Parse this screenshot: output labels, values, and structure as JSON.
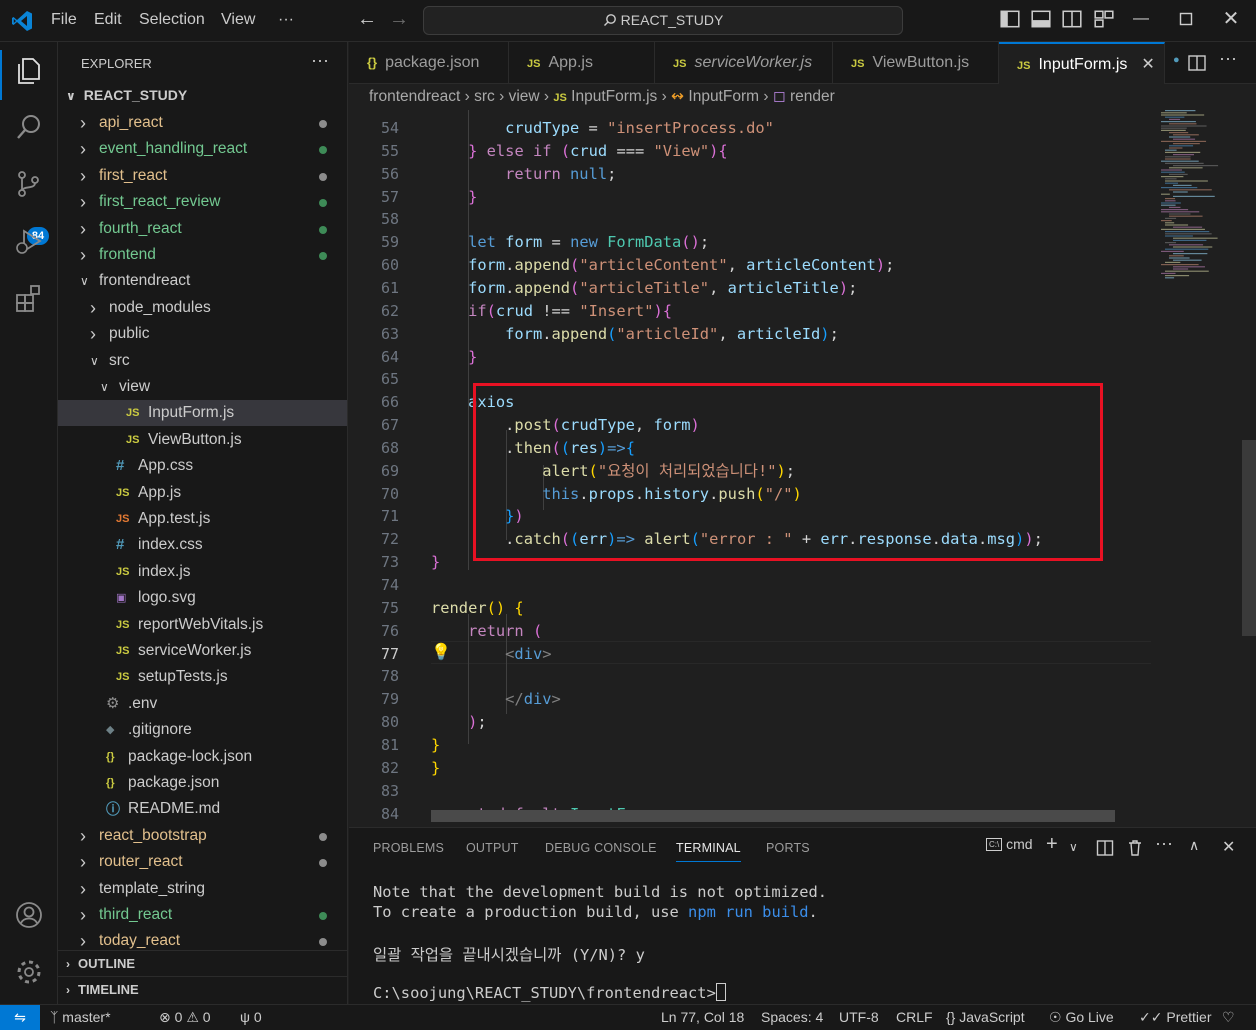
{
  "titlebar": {
    "menu": [
      "File",
      "Edit",
      "Selection",
      "View",
      "···"
    ],
    "search": "REACT_STUDY",
    "brand_color": "#0078d4"
  },
  "activitybar": {
    "items": [
      "explorer-icon",
      "search-icon",
      "source-control-icon",
      "run-debug-icon",
      "extensions-icon",
      "account-icon",
      "settings-icon"
    ],
    "scm_badge": "84"
  },
  "explorer": {
    "title": "EXPLORER",
    "more": "···",
    "root": "REACT_STUDY",
    "tree": [
      {
        "label": "api_react",
        "type": "folder",
        "open": false,
        "depth": 0,
        "status": "mod"
      },
      {
        "label": "event_handling_react",
        "type": "folder",
        "open": false,
        "depth": 0,
        "status": "add"
      },
      {
        "label": "first_react",
        "type": "folder",
        "open": false,
        "depth": 0,
        "status": "mod"
      },
      {
        "label": "first_react_review",
        "type": "folder",
        "open": false,
        "depth": 0,
        "status": "add"
      },
      {
        "label": "fourth_react",
        "type": "folder",
        "open": false,
        "depth": 0,
        "status": "add"
      },
      {
        "label": "frontend",
        "type": "folder",
        "open": false,
        "depth": 0,
        "status": "add"
      },
      {
        "label": "frontendreact",
        "type": "folder",
        "open": true,
        "depth": 0,
        "status": ""
      },
      {
        "label": "node_modules",
        "type": "folder",
        "open": false,
        "depth": 1,
        "status": ""
      },
      {
        "label": "public",
        "type": "folder",
        "open": false,
        "depth": 1,
        "status": ""
      },
      {
        "label": "src",
        "type": "folder",
        "open": true,
        "depth": 1,
        "status": ""
      },
      {
        "label": "view",
        "type": "folder",
        "open": true,
        "depth": 2,
        "status": ""
      },
      {
        "label": "InputForm.js",
        "type": "js",
        "depth": 3,
        "status": "",
        "selected": true
      },
      {
        "label": "ViewButton.js",
        "type": "js",
        "depth": 3,
        "status": ""
      },
      {
        "label": "App.css",
        "type": "css",
        "depth": 2,
        "status": ""
      },
      {
        "label": "App.js",
        "type": "js",
        "depth": 2,
        "status": ""
      },
      {
        "label": "App.test.js",
        "type": "jstest",
        "depth": 2,
        "status": ""
      },
      {
        "label": "index.css",
        "type": "css",
        "depth": 2,
        "status": ""
      },
      {
        "label": "index.js",
        "type": "js",
        "depth": 2,
        "status": ""
      },
      {
        "label": "logo.svg",
        "type": "svg",
        "depth": 2,
        "status": ""
      },
      {
        "label": "reportWebVitals.js",
        "type": "js",
        "depth": 2,
        "status": ""
      },
      {
        "label": "serviceWorker.js",
        "type": "js",
        "depth": 2,
        "status": ""
      },
      {
        "label": "setupTests.js",
        "type": "js",
        "depth": 2,
        "status": ""
      },
      {
        "label": ".env",
        "type": "gear",
        "depth": 1,
        "status": ""
      },
      {
        "label": ".gitignore",
        "type": "git",
        "depth": 1,
        "status": ""
      },
      {
        "label": "package-lock.json",
        "type": "json",
        "depth": 1,
        "status": ""
      },
      {
        "label": "package.json",
        "type": "json",
        "depth": 1,
        "status": ""
      },
      {
        "label": "README.md",
        "type": "info",
        "depth": 1,
        "status": ""
      },
      {
        "label": "react_bootstrap",
        "type": "folder",
        "open": false,
        "depth": 0,
        "status": "mod"
      },
      {
        "label": "router_react",
        "type": "folder",
        "open": false,
        "depth": 0,
        "status": "mod"
      },
      {
        "label": "template_string",
        "type": "folder",
        "open": false,
        "depth": 0,
        "status": ""
      },
      {
        "label": "third_react",
        "type": "folder",
        "open": false,
        "depth": 0,
        "status": "add"
      },
      {
        "label": "today_react",
        "type": "folder",
        "open": false,
        "depth": 0,
        "status": "mod"
      }
    ],
    "outline": "OUTLINE",
    "timeline": "TIMELINE"
  },
  "tabs": [
    {
      "label": "package.json",
      "icon": "{}",
      "italic": false
    },
    {
      "label": "App.js",
      "icon": "JS",
      "italic": false
    },
    {
      "label": "serviceWorker.js",
      "icon": "JS",
      "italic": true
    },
    {
      "label": "ViewButton.js",
      "icon": "JS",
      "italic": false
    },
    {
      "label": "InputForm.js",
      "icon": "JS",
      "italic": false,
      "active": true
    }
  ],
  "breadcrumb": [
    "frontendreact",
    "src",
    "view",
    "InputForm.js",
    "InputForm",
    "render"
  ],
  "editor": {
    "current_line": 77,
    "lines": [
      {
        "n": 54,
        "tokens": [
          [
            "        ",
            ""
          ],
          [
            "crudType",
            "id"
          ],
          [
            " = ",
            "op"
          ],
          [
            "\"insertProcess.do\"",
            "str"
          ]
        ]
      },
      {
        "n": 55,
        "tokens": [
          [
            "    ",
            ""
          ],
          [
            "}",
            "pb"
          ],
          [
            " ",
            ""
          ],
          [
            "else",
            "kw"
          ],
          [
            " ",
            ""
          ],
          [
            "if",
            "kw"
          ],
          [
            " ",
            ""
          ],
          [
            "(",
            "pb"
          ],
          [
            "crud",
            "id"
          ],
          [
            " === ",
            "op"
          ],
          [
            "\"View\"",
            "str"
          ],
          [
            ")",
            "pb"
          ],
          [
            "{",
            "pb"
          ]
        ]
      },
      {
        "n": 56,
        "tokens": [
          [
            "        ",
            ""
          ],
          [
            "return",
            "kw"
          ],
          [
            " ",
            ""
          ],
          [
            "null",
            "kb"
          ],
          [
            ";",
            "op"
          ]
        ]
      },
      {
        "n": 57,
        "tokens": [
          [
            "    ",
            ""
          ],
          [
            "}",
            "pb"
          ]
        ]
      },
      {
        "n": 58,
        "tokens": []
      },
      {
        "n": 59,
        "tokens": [
          [
            "    ",
            ""
          ],
          [
            "let",
            "kb"
          ],
          [
            " ",
            ""
          ],
          [
            "form",
            "id"
          ],
          [
            " = ",
            "op"
          ],
          [
            "new",
            "kb"
          ],
          [
            " ",
            ""
          ],
          [
            "FormData",
            "cls"
          ],
          [
            "()",
            "pb"
          ],
          [
            ";",
            "op"
          ]
        ]
      },
      {
        "n": 60,
        "tokens": [
          [
            "    ",
            ""
          ],
          [
            "form",
            "id"
          ],
          [
            ".",
            "op"
          ],
          [
            "append",
            "fn"
          ],
          [
            "(",
            "pb"
          ],
          [
            "\"articleContent\"",
            "str"
          ],
          [
            ", ",
            "op"
          ],
          [
            "articleContent",
            "id"
          ],
          [
            ")",
            "pb"
          ],
          [
            ";",
            "op"
          ]
        ]
      },
      {
        "n": 61,
        "tokens": [
          [
            "    ",
            ""
          ],
          [
            "form",
            "id"
          ],
          [
            ".",
            "op"
          ],
          [
            "append",
            "fn"
          ],
          [
            "(",
            "pb"
          ],
          [
            "\"articleTitle\"",
            "str"
          ],
          [
            ", ",
            "op"
          ],
          [
            "articleTitle",
            "id"
          ],
          [
            ")",
            "pb"
          ],
          [
            ";",
            "op"
          ]
        ]
      },
      {
        "n": 62,
        "tokens": [
          [
            "    ",
            ""
          ],
          [
            "if",
            "kw"
          ],
          [
            "(",
            "pb"
          ],
          [
            "crud",
            "id"
          ],
          [
            " !== ",
            "op"
          ],
          [
            "\"Insert\"",
            "str"
          ],
          [
            ")",
            "pb"
          ],
          [
            "{",
            "pb"
          ]
        ]
      },
      {
        "n": 63,
        "tokens": [
          [
            "        ",
            ""
          ],
          [
            "form",
            "id"
          ],
          [
            ".",
            "op"
          ],
          [
            "append",
            "fn"
          ],
          [
            "(",
            "pbl"
          ],
          [
            "\"articleId\"",
            "str"
          ],
          [
            ", ",
            "op"
          ],
          [
            "articleId",
            "id"
          ],
          [
            ")",
            "pbl"
          ],
          [
            ";",
            "op"
          ]
        ]
      },
      {
        "n": 64,
        "tokens": [
          [
            "    ",
            ""
          ],
          [
            "}",
            "pb"
          ]
        ]
      },
      {
        "n": 65,
        "tokens": []
      },
      {
        "n": 66,
        "tokens": [
          [
            "    ",
            ""
          ],
          [
            "axios",
            "id"
          ]
        ]
      },
      {
        "n": 67,
        "tokens": [
          [
            "        ",
            ""
          ],
          [
            ".",
            "op"
          ],
          [
            "post",
            "fn"
          ],
          [
            "(",
            "pb"
          ],
          [
            "crudType",
            "id"
          ],
          [
            ", ",
            "op"
          ],
          [
            "form",
            "id"
          ],
          [
            ")",
            "pb"
          ]
        ]
      },
      {
        "n": 68,
        "tokens": [
          [
            "        ",
            ""
          ],
          [
            ".",
            "op"
          ],
          [
            "then",
            "fn"
          ],
          [
            "(",
            "pb"
          ],
          [
            "(",
            "pbl"
          ],
          [
            "res",
            "id"
          ],
          [
            ")",
            "pbl"
          ],
          [
            "=>",
            "kb"
          ],
          [
            "{",
            "pbl"
          ]
        ]
      },
      {
        "n": 69,
        "tokens": [
          [
            "            ",
            ""
          ],
          [
            "alert",
            "fn"
          ],
          [
            "(",
            "py"
          ],
          [
            "\"요청이 처리되었습니다!\"",
            "str"
          ],
          [
            ")",
            "py"
          ],
          [
            ";",
            "op"
          ]
        ]
      },
      {
        "n": 70,
        "tokens": [
          [
            "            ",
            ""
          ],
          [
            "this",
            "kb"
          ],
          [
            ".",
            "op"
          ],
          [
            "props",
            "id"
          ],
          [
            ".",
            "op"
          ],
          [
            "history",
            "id"
          ],
          [
            ".",
            "op"
          ],
          [
            "push",
            "fn"
          ],
          [
            "(",
            "py"
          ],
          [
            "\"/\"",
            "str"
          ],
          [
            ")",
            "py"
          ]
        ]
      },
      {
        "n": 71,
        "tokens": [
          [
            "        ",
            ""
          ],
          [
            "}",
            "pbl"
          ],
          [
            ")",
            "pb"
          ]
        ]
      },
      {
        "n": 72,
        "tokens": [
          [
            "        ",
            ""
          ],
          [
            ".",
            "op"
          ],
          [
            "catch",
            "fn"
          ],
          [
            "(",
            "pb"
          ],
          [
            "(",
            "pbl"
          ],
          [
            "err",
            "id"
          ],
          [
            ")",
            "pbl"
          ],
          [
            "=>",
            "kb"
          ],
          [
            " ",
            ""
          ],
          [
            "alert",
            "fn"
          ],
          [
            "(",
            "pbl"
          ],
          [
            "\"error : \"",
            "str"
          ],
          [
            " + ",
            "op"
          ],
          [
            "err",
            "id"
          ],
          [
            ".",
            "op"
          ],
          [
            "response",
            "id"
          ],
          [
            ".",
            "op"
          ],
          [
            "data",
            "id"
          ],
          [
            ".",
            "op"
          ],
          [
            "msg",
            "id"
          ],
          [
            ")",
            "pbl"
          ],
          [
            ")",
            "pb"
          ],
          [
            ";",
            "op"
          ]
        ]
      },
      {
        "n": 73,
        "tokens": [
          [
            "",
            ""
          ],
          [
            "}",
            "pb"
          ]
        ]
      },
      {
        "n": 74,
        "tokens": []
      },
      {
        "n": 75,
        "tokens": [
          [
            "",
            ""
          ],
          [
            "render",
            "fn"
          ],
          [
            "() ",
            "py"
          ],
          [
            "{",
            "py"
          ]
        ]
      },
      {
        "n": 76,
        "tokens": [
          [
            "    ",
            ""
          ],
          [
            "return",
            "kw"
          ],
          [
            " ",
            ""
          ],
          [
            "(",
            "pb"
          ]
        ]
      },
      {
        "n": 77,
        "tokens": [
          [
            "        ",
            ""
          ],
          [
            "<",
            "tag"
          ],
          [
            "div",
            "tagn"
          ],
          [
            ">",
            "tag"
          ]
        ]
      },
      {
        "n": 78,
        "tokens": []
      },
      {
        "n": 79,
        "tokens": [
          [
            "        ",
            ""
          ],
          [
            "</",
            "tag"
          ],
          [
            "div",
            "tagn"
          ],
          [
            ">",
            "tag"
          ]
        ]
      },
      {
        "n": 80,
        "tokens": [
          [
            "    ",
            ""
          ],
          [
            ")",
            "pb"
          ],
          [
            ";",
            "op"
          ]
        ]
      },
      {
        "n": 81,
        "tokens": [
          [
            "",
            ""
          ],
          [
            "}",
            "py"
          ]
        ]
      },
      {
        "n": 82,
        "tokens": [
          [
            "",
            ""
          ],
          [
            "}",
            "py"
          ]
        ]
      },
      {
        "n": 83,
        "tokens": []
      },
      {
        "n": 84,
        "tokens": [
          [
            "",
            ""
          ],
          [
            "export",
            "kw"
          ],
          [
            " ",
            ""
          ],
          [
            "default",
            "kw"
          ],
          [
            " ",
            ""
          ],
          [
            "InputForm",
            "cls"
          ],
          [
            ";",
            "op"
          ]
        ]
      }
    ]
  },
  "panel": {
    "tabs": [
      "PROBLEMS",
      "OUTPUT",
      "DEBUG CONSOLE",
      "TERMINAL",
      "PORTS"
    ],
    "active_tab": "TERMINAL",
    "shell": "cmd",
    "terminal": {
      "line1": "Note that the development build is not optimized.",
      "line2_prefix": "To create a production build, use ",
      "line2_cmd": "npm run build",
      "line2_suffix": ".",
      "line3": "일괄 작업을 끝내시겠습니까 (Y/N)? y",
      "prompt": "C:\\soojung\\REACT_STUDY\\frontendreact>"
    }
  },
  "statusbar": {
    "branch": "master*",
    "errors": "0",
    "warnings": "0",
    "ports": "0",
    "position": "Ln 77, Col 18",
    "spaces": "Spaces: 4",
    "encoding": "UTF-8",
    "eol": "CRLF",
    "language": "JavaScript",
    "golive": "Go Live",
    "prettier": "Prettier"
  }
}
